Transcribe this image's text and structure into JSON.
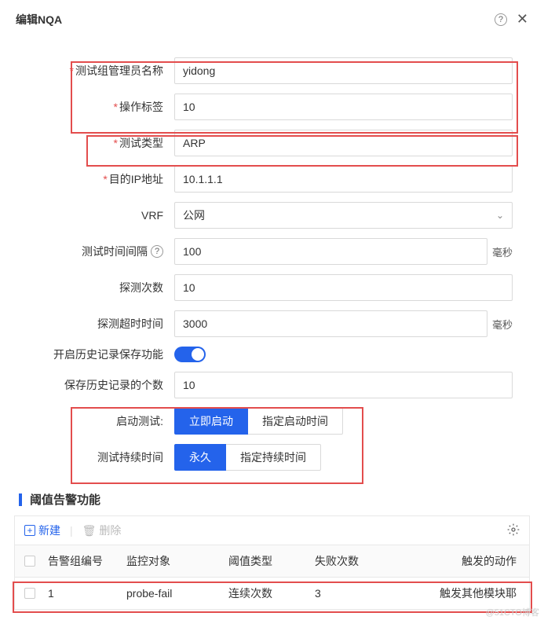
{
  "header": {
    "title": "编辑NQA"
  },
  "form": {
    "admin_name": {
      "label": "测试组管理员名称",
      "value": "yidong"
    },
    "op_tag": {
      "label": "操作标签",
      "value": "10"
    },
    "test_type": {
      "label": "测试类型",
      "value": "ARP"
    },
    "dest_ip": {
      "label": "目的IP地址",
      "value": "10.1.1.1"
    },
    "vrf": {
      "label": "VRF",
      "value": "公网"
    },
    "interval": {
      "label": "测试时间间隔",
      "value": "100",
      "suffix": "毫秒"
    },
    "probe_count": {
      "label": "探测次数",
      "value": "10"
    },
    "probe_timeout": {
      "label": "探测超时时间",
      "value": "3000",
      "suffix": "毫秒"
    },
    "history_enable": {
      "label": "开启历史记录保存功能"
    },
    "history_count": {
      "label": "保存历史记录的个数",
      "value": "10"
    },
    "start_test": {
      "label": "启动测试:",
      "opt1": "立即启动",
      "opt2": "指定启动时间"
    },
    "duration": {
      "label": "测试持续时间",
      "opt1": "永久",
      "opt2": "指定持续时间"
    }
  },
  "section": {
    "title": "阈值告警功能"
  },
  "toolbar": {
    "new": "新建",
    "delete": "删除"
  },
  "table": {
    "headers": {
      "c1": "告警组编号",
      "c2": "监控对象",
      "c3": "阈值类型",
      "c4": "失败次数",
      "c5": "触发的动作"
    },
    "rows": [
      {
        "c1": "1",
        "c2": "probe-fail",
        "c3": "连续次数",
        "c4": "3",
        "c5": "触发其他模块耶"
      }
    ]
  },
  "watermark": "@51CTO博客"
}
